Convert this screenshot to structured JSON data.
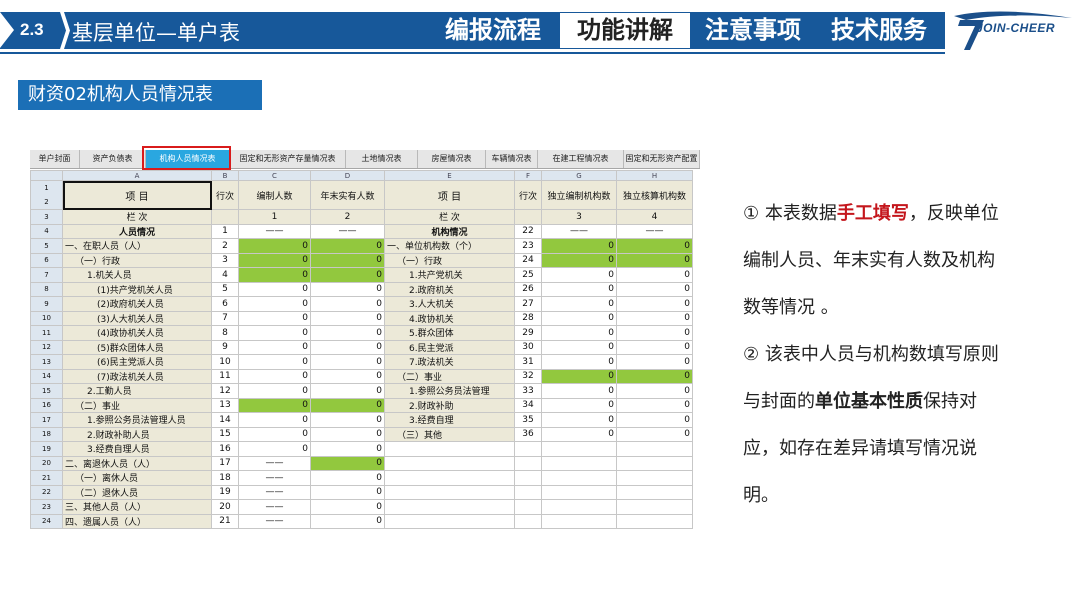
{
  "header": {
    "section_number": "2.3",
    "section_title": "基层单位—单户表",
    "nav": [
      {
        "label": "编报流程",
        "active": false
      },
      {
        "label": "功能讲解",
        "active": true
      },
      {
        "label": "注意事项",
        "active": false
      },
      {
        "label": "技术服务",
        "active": false
      }
    ],
    "logo_text": "JOIN-CHEER"
  },
  "subtitle": "财资02机构人员情况表",
  "tabs": [
    "单户封面",
    "资产负债表",
    "机构人员情况表",
    "固定和无形资产存量情况表",
    "土地情况表",
    "房屋情况表",
    "车辆情况表",
    "在建工程情况表",
    "固定和无形资产配置"
  ],
  "active_tab": 2,
  "sheet": {
    "col_letters": [
      "A",
      "B",
      "C",
      "D",
      "E",
      "F",
      "G",
      "H"
    ],
    "header": {
      "item": "项  目",
      "row_no": "行次",
      "staff_quota": "编制人数",
      "actual_staff": "年末实有人数",
      "item2": "项  目",
      "row_no2": "行次",
      "independent_quota_orgs": "独立编制机构数",
      "independent_account_orgs": "独立核算机构数",
      "col_label": "栏  次",
      "c1": "1",
      "c2": "2",
      "c3": "3",
      "c4": "4",
      "dash": "——"
    },
    "row4": {
      "left": "人员情况",
      "left_no": "1",
      "right": "机构情况",
      "right_no": "22"
    },
    "rows": [
      {
        "rn": "5",
        "a": "一、在职人员（人）",
        "b": "2",
        "c": "0",
        "d": "0",
        "e": "一、单位机构数（个）",
        "f": "23",
        "g": "0",
        "h": "0",
        "cg": true,
        "dg": true,
        "gg": true,
        "hg": true,
        "ind": 0,
        "eind": 0
      },
      {
        "rn": "6",
        "a": "（一）行政",
        "b": "3",
        "c": "0",
        "d": "0",
        "e": "（一）行政",
        "f": "24",
        "g": "0",
        "h": "0",
        "cg": true,
        "dg": true,
        "gg": true,
        "hg": true,
        "ind": 1,
        "eind": 1
      },
      {
        "rn": "7",
        "a": "1.机关人员",
        "b": "4",
        "c": "0",
        "d": "0",
        "e": "1.共产党机关",
        "f": "25",
        "g": "0",
        "h": "0",
        "cg": true,
        "dg": true,
        "ind": 2,
        "eind": 2
      },
      {
        "rn": "8",
        "a": "(1)共产党机关人员",
        "b": "5",
        "c": "0",
        "d": "0",
        "e": "2.政府机关",
        "f": "26",
        "g": "0",
        "h": "0",
        "ind": 3,
        "eind": 2
      },
      {
        "rn": "9",
        "a": "(2)政府机关人员",
        "b": "6",
        "c": "0",
        "d": "0",
        "e": "3.人大机关",
        "f": "27",
        "g": "0",
        "h": "0",
        "ind": 3,
        "eind": 2
      },
      {
        "rn": "10",
        "a": "(3)人大机关人员",
        "b": "7",
        "c": "0",
        "d": "0",
        "e": "4.政协机关",
        "f": "28",
        "g": "0",
        "h": "0",
        "ind": 3,
        "eind": 2
      },
      {
        "rn": "11",
        "a": "(4)政协机关人员",
        "b": "8",
        "c": "0",
        "d": "0",
        "e": "5.群众团体",
        "f": "29",
        "g": "0",
        "h": "0",
        "ind": 3,
        "eind": 2
      },
      {
        "rn": "12",
        "a": "(5)群众团体人员",
        "b": "9",
        "c": "0",
        "d": "0",
        "e": "6.民主党派",
        "f": "30",
        "g": "0",
        "h": "0",
        "ind": 3,
        "eind": 2
      },
      {
        "rn": "13",
        "a": "(6)民主党派人员",
        "b": "10",
        "c": "0",
        "d": "0",
        "e": "7.政法机关",
        "f": "31",
        "g": "0",
        "h": "0",
        "ind": 3,
        "eind": 2
      },
      {
        "rn": "14",
        "a": "(7)政法机关人员",
        "b": "11",
        "c": "0",
        "d": "0",
        "e": "（二）事业",
        "f": "32",
        "g": "0",
        "h": "0",
        "gg": true,
        "hg": true,
        "ind": 3,
        "eind": 1
      },
      {
        "rn": "15",
        "a": "2.工勤人员",
        "b": "12",
        "c": "0",
        "d": "0",
        "e": "1.参照公务员法管理",
        "f": "33",
        "g": "0",
        "h": "0",
        "ind": 2,
        "eind": 2
      },
      {
        "rn": "16",
        "a": "（二）事业",
        "b": "13",
        "c": "0",
        "d": "0",
        "e": "2.财政补助",
        "f": "34",
        "g": "0",
        "h": "0",
        "cg": true,
        "dg": true,
        "ind": 1,
        "eind": 2
      },
      {
        "rn": "17",
        "a": "1.参照公务员法管理人员",
        "b": "14",
        "c": "0",
        "d": "0",
        "e": "3.经费自理",
        "f": "35",
        "g": "0",
        "h": "0",
        "ind": 2,
        "eind": 2
      },
      {
        "rn": "18",
        "a": "2.财政补助人员",
        "b": "15",
        "c": "0",
        "d": "0",
        "e": "（三）其他",
        "f": "36",
        "g": "0",
        "h": "0",
        "ind": 2,
        "eind": 1
      },
      {
        "rn": "19",
        "a": "3.经费自理人员",
        "b": "16",
        "c": "0",
        "d": "0",
        "e": "",
        "f": "",
        "g": "",
        "h": "",
        "ind": 2,
        "eind": 0
      },
      {
        "rn": "20",
        "a": "二、离退休人员（人）",
        "b": "17",
        "c": "——",
        "d": "0",
        "e": "",
        "f": "",
        "g": "",
        "h": "",
        "dg": true,
        "ind": 0,
        "eind": 0
      },
      {
        "rn": "21",
        "a": "（一）离休人员",
        "b": "18",
        "c": "——",
        "d": "0",
        "e": "",
        "f": "",
        "g": "",
        "h": "",
        "ind": 1,
        "eind": 0
      },
      {
        "rn": "22",
        "a": "（二）退休人员",
        "b": "19",
        "c": "——",
        "d": "0",
        "e": "",
        "f": "",
        "g": "",
        "h": "",
        "ind": 1,
        "eind": 0
      },
      {
        "rn": "23",
        "a": "三、其他人员（人）",
        "b": "20",
        "c": "——",
        "d": "0",
        "e": "",
        "f": "",
        "g": "",
        "h": "",
        "ind": 0,
        "eind": 0
      },
      {
        "rn": "24",
        "a": "四、遗属人员（人）",
        "b": "21",
        "c": "——",
        "d": "0",
        "e": "",
        "f": "",
        "g": "",
        "h": "",
        "ind": 0,
        "eind": 0
      }
    ]
  },
  "description": {
    "p1_pre": "① 本表数据",
    "p1_red": "手工填写",
    "p1_post": "，反映单位",
    "p1_line2": "编制人员、年末实有人数及机构",
    "p1_line3": "数等情况 。",
    "p2_line1": "② 该表中人员与机构数填写原则",
    "p2_pre": "与封面的",
    "p2_bold": "单位基本性质",
    "p2_post": "保持对",
    "p2_line3": "应，如存在差异请填写情况说",
    "p2_line4": "明。"
  },
  "colors": {
    "header_blue": "#17589a",
    "subtitle_blue": "#1b6fb6",
    "cell_green": "#92c83e",
    "cell_beige": "#ece9d8",
    "tab_active": "#2aa7e0",
    "highlight_red": "#d91b1b",
    "emphasis_red": "#c4161c"
  }
}
